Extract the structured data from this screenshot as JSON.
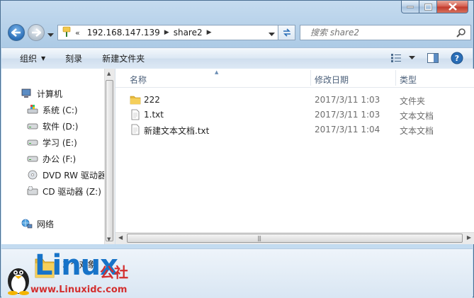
{
  "window": {
    "title": ""
  },
  "address": {
    "overflow": "«",
    "segments": [
      "192.168.147.139",
      "share2"
    ]
  },
  "search": {
    "placeholder": "搜索 share2"
  },
  "toolbar": {
    "organize": "组织",
    "burn": "刻录",
    "new_folder": "新建文件夹"
  },
  "sidebar": {
    "items": [
      {
        "label": "计算机",
        "icon": "computer-icon"
      },
      {
        "label": "系统 (C:)",
        "icon": "system-drive-icon"
      },
      {
        "label": "软件 (D:)",
        "icon": "drive-icon"
      },
      {
        "label": "学习 (E:)",
        "icon": "drive-icon"
      },
      {
        "label": "办公 (F:)",
        "icon": "drive-icon"
      },
      {
        "label": "DVD RW 驱动器",
        "icon": "dvd-drive-icon"
      },
      {
        "label": "CD 驱动器 (Z:)",
        "icon": "cd-drive-icon"
      },
      {
        "label": "网络",
        "icon": "network-icon"
      }
    ]
  },
  "columns": {
    "name": "名称",
    "date": "修改日期",
    "type": "类型"
  },
  "files": [
    {
      "name": "222",
      "date": "2017/3/11 1:03",
      "type": "文件夹",
      "icon": "folder-icon"
    },
    {
      "name": "1.txt",
      "date": "2017/3/11 1:03",
      "type": "文本文档",
      "icon": "text-file-icon"
    },
    {
      "name": "新建文本文档.txt",
      "date": "2017/3/11 1:04",
      "type": "文本文档",
      "icon": "text-file-icon"
    }
  ],
  "status": {
    "count": "3 个对象"
  },
  "watermark": {
    "brand": "Linux",
    "suffix": "公社",
    "url": "www.Linuxidc.com"
  },
  "colors": {
    "accent": "#1773c8",
    "watermark_red": "#d32f2f",
    "close_button": "#c0392b"
  }
}
